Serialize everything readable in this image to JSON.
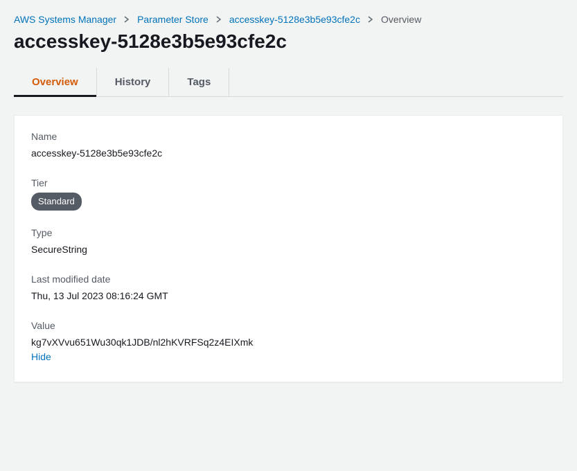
{
  "breadcrumb": {
    "items": [
      {
        "label": "AWS Systems Manager"
      },
      {
        "label": "Parameter Store"
      },
      {
        "label": "accesskey-5128e3b5e93cfe2c"
      }
    ],
    "current": "Overview"
  },
  "page_title": "accesskey-5128e3b5e93cfe2c",
  "tabs": {
    "overview": "Overview",
    "history": "History",
    "tags": "Tags"
  },
  "details": {
    "name_label": "Name",
    "name_value": "accesskey-5128e3b5e93cfe2c",
    "tier_label": "Tier",
    "tier_value": "Standard",
    "type_label": "Type",
    "type_value": "SecureString",
    "modified_label": "Last modified date",
    "modified_value": "Thu, 13 Jul 2023 08:16:24 GMT",
    "value_label": "Value",
    "value_value": "kg7vXVvu651Wu30qk1JDB/nl2hKVRFSq2z4EIXmk",
    "hide_action": "Hide"
  }
}
